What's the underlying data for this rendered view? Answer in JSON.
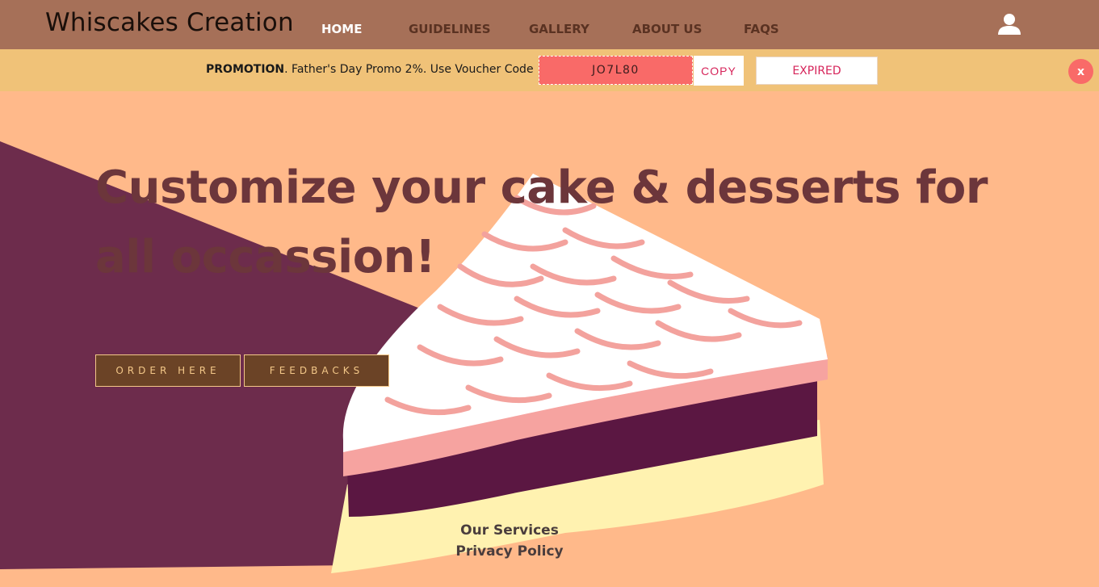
{
  "nav": {
    "brand": "Whiscakes Creation",
    "links": [
      "HOME",
      "GUIDELINES",
      "GALLERY",
      "ABOUT US",
      "FAQS"
    ],
    "user_icon": "user-icon"
  },
  "promo": {
    "label": "PROMOTION",
    "text": ". Father's Day Promo 2%. Use Voucher Code",
    "voucher_code": "JO7L80",
    "copy_label": "COPY",
    "status_label": "EXPIRED",
    "close_label": "x"
  },
  "hero": {
    "headline": "Customize your cake & desserts for all occassion!",
    "buttons": [
      "ORDER HERE",
      "FEEDBACKS"
    ]
  },
  "footer": {
    "links": [
      "Our Services",
      "Privacy Policy"
    ]
  },
  "colors": {
    "navbar": "#a67058",
    "promo_bar": "#f0c278",
    "hero_bg": "#ffb98a",
    "voucher_bg": "#f96a68",
    "accent_text": "#d6245a",
    "headline": "#6c363b",
    "button_bg": "#6b4326",
    "button_border": "#f3c788"
  }
}
